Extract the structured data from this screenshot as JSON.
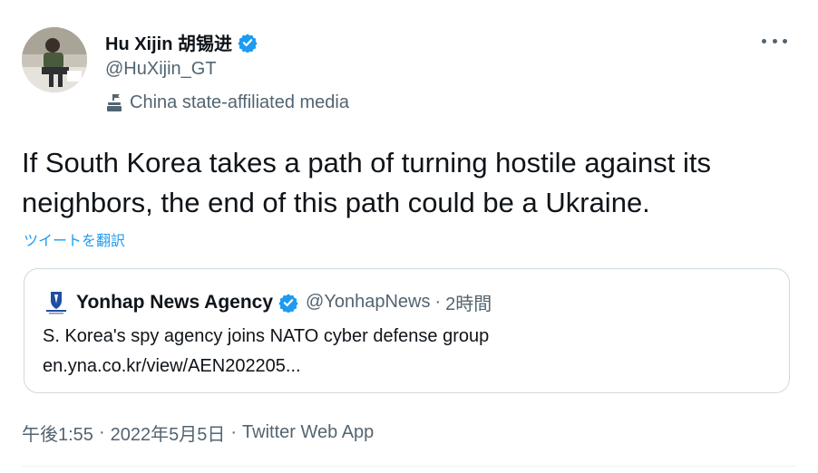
{
  "author": {
    "display_name": "Hu Xijin 胡锡进",
    "handle": "@HuXijin_GT",
    "affiliation_label": "China state-affiliated media",
    "avatar_icon": "person-sitting-avatar",
    "verified_icon": "verified-badge-icon"
  },
  "tweet": {
    "text": "If South Korea takes a path of turning hostile against its neighbors, the end of this path could be a Ukraine.",
    "translate_label": "ツイートを翻訳"
  },
  "quoted": {
    "display_name": "Yonhap News Agency",
    "handle": "@YonhapNews",
    "separator": "·",
    "time": "2時間",
    "text_line1": "S. Korea's spy agency joins NATO cyber defense group",
    "text_line2": "en.yna.co.kr/view/AEN202205...",
    "logo_icon": "yonhap-logo"
  },
  "meta": {
    "time": "午後1:55",
    "dot1": "·",
    "date": "2022年5月5日",
    "dot2": "·",
    "source": "Twitter Web App"
  },
  "colors": {
    "accent": "#1d9bf0",
    "secondary_text": "#536471",
    "border": "#cfd9de"
  }
}
